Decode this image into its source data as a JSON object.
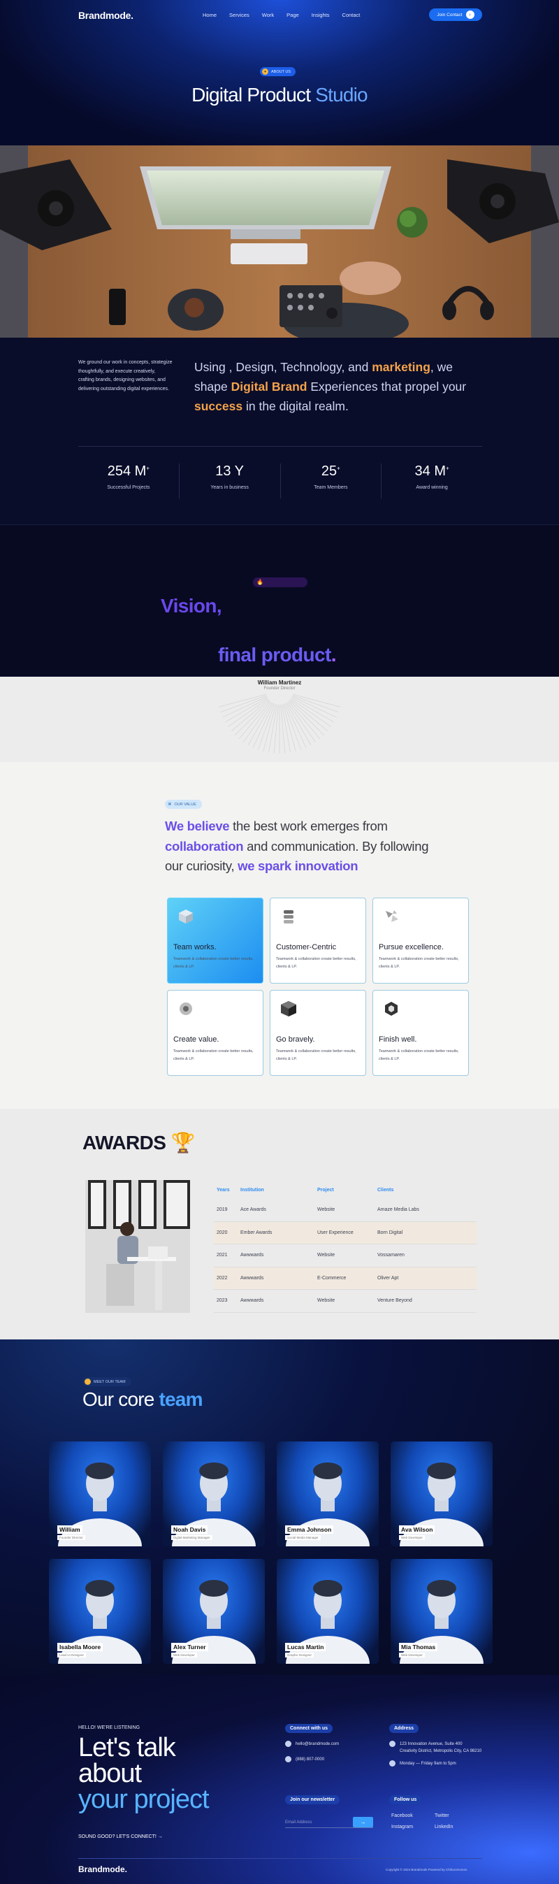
{
  "nav": {
    "logo": "Brandmode.",
    "links": [
      "Home",
      "Services",
      "Work",
      "Page",
      "Insights",
      "Contact"
    ],
    "cta": "Join Contact"
  },
  "hero": {
    "badge": "ABOUT US",
    "title_plain": "Digital Product",
    "title_accent": "Studio"
  },
  "intro": {
    "small": "We ground our work in concepts, strategize thoughtfully, and execute creatively, crafting brands, designing websites, and delivering outstanding digital experiences.",
    "big_1": "Using , Design, Technology, and",
    "big_b1": "marketing",
    "big_2": ", we shape",
    "big_b2": "Digital Brand",
    "big_3": "Experiences that propel your",
    "big_b3": "success",
    "big_4": "in the digital realm."
  },
  "stats": [
    {
      "value": "254 M",
      "sup": "+",
      "label": "Successful Projects"
    },
    {
      "value": "13 Y",
      "sup": "",
      "label": "Years in business"
    },
    {
      "value": "25",
      "sup": "+",
      "label": "Team Members"
    },
    {
      "value": "34 M",
      "sup": "+",
      "label": "Award winning"
    }
  ],
  "vision": {
    "badge_icon": "fire-icon",
    "word1": "Vision,",
    "word2": "final product",
    "word2_dot": "."
  },
  "testimonial": {
    "name": "William Martinez",
    "role": "Founder Director"
  },
  "values": {
    "badge": "OUR VALUE",
    "t1": "We believe",
    "t2": " the best work emerges from ",
    "t3": "collaboration",
    "t4": " and communication. By following our curiosity, ",
    "t5": "we spark innovation",
    "cards": [
      {
        "title": "Team works.",
        "desc": "Teamwork & collaboration create better results, clients & LP.",
        "icon": "cube-icon"
      },
      {
        "title": "Customer-Centric",
        "desc": "Teamwork & collaboration create better results, clients & LP.",
        "icon": "stack-icon"
      },
      {
        "title": "Pursue excellence.",
        "desc": "Teamwork & collaboration create better results, clients & LP.",
        "icon": "shards-icon"
      },
      {
        "title": "Create value.",
        "desc": "Teamwork & collaboration create better results, clients & LP.",
        "icon": "gear-shape-icon"
      },
      {
        "title": "Go bravely.",
        "desc": "Teamwork & collaboration create better results, clients & LP.",
        "icon": "box-icon"
      },
      {
        "title": "Finish well.",
        "desc": "Teamwork & collaboration create better results, clients & LP.",
        "icon": "hex-icon"
      }
    ]
  },
  "awards": {
    "title": "AWARDS",
    "trophy": "🏆",
    "headers": [
      "Years",
      "Institution",
      "Project",
      "Clients"
    ],
    "rows": [
      [
        "2019",
        "Ace Awards",
        "Website",
        "Amaze Media Labs"
      ],
      [
        "2020",
        "Ember Awards",
        "User Experience",
        "Born Digital"
      ],
      [
        "2021",
        "Awwwards",
        "Website",
        "Vossamaren"
      ],
      [
        "2022",
        "Awwwards",
        "E-Commerce",
        "Oliver Apt"
      ],
      [
        "2023",
        "Awwwards",
        "Website",
        "Venture Beyond"
      ]
    ]
  },
  "team": {
    "badge": "MEET OUR TEAM",
    "title_plain": "Our core",
    "title_accent": "team",
    "members": [
      {
        "name": "William",
        "role": "Founder Director"
      },
      {
        "name": "Noah Davis",
        "role": "Digital Marketing Manager"
      },
      {
        "name": "Emma Johnson",
        "role": "Social Media Manager"
      },
      {
        "name": "Ava Wilson",
        "role": "Web Developer"
      },
      {
        "name": "Isabella Moore",
        "role": "Lead UI Designer"
      },
      {
        "name": "Alex Turner",
        "role": "Web Developer"
      },
      {
        "name": "Lucas Martin",
        "role": "Graphic Designer"
      },
      {
        "name": "Mia Thomas",
        "role": "Web Developer"
      }
    ]
  },
  "contact": {
    "hello": "HELLO! WE'RE LISTENING",
    "big1": "Let's talk",
    "big2": "about",
    "big3": "your project",
    "sound": "SOUND GOOD? LET'S CONNECT! →",
    "connect_head": "Connect with us",
    "email": "hello@brandmode.com",
    "phone": "(888) 807-0000",
    "address_head": "Address",
    "address1": "123 Innovation Avenue, Suite 400",
    "address2": "Creativity District, Metropolis City, CA 98210",
    "hours": "Monday — Friday 9am to 5pm",
    "newsletter_head": "Join our newsletter",
    "email_placeholder": "Email Address",
    "follow_head": "Follow us",
    "social": [
      "Facebook",
      "Twitter",
      "Instagram",
      "LinkedIn"
    ],
    "footer_logo": "Brandmode.",
    "copyright": "Copyright © 2024 Brandmode Powered by ChiliconHonors"
  }
}
